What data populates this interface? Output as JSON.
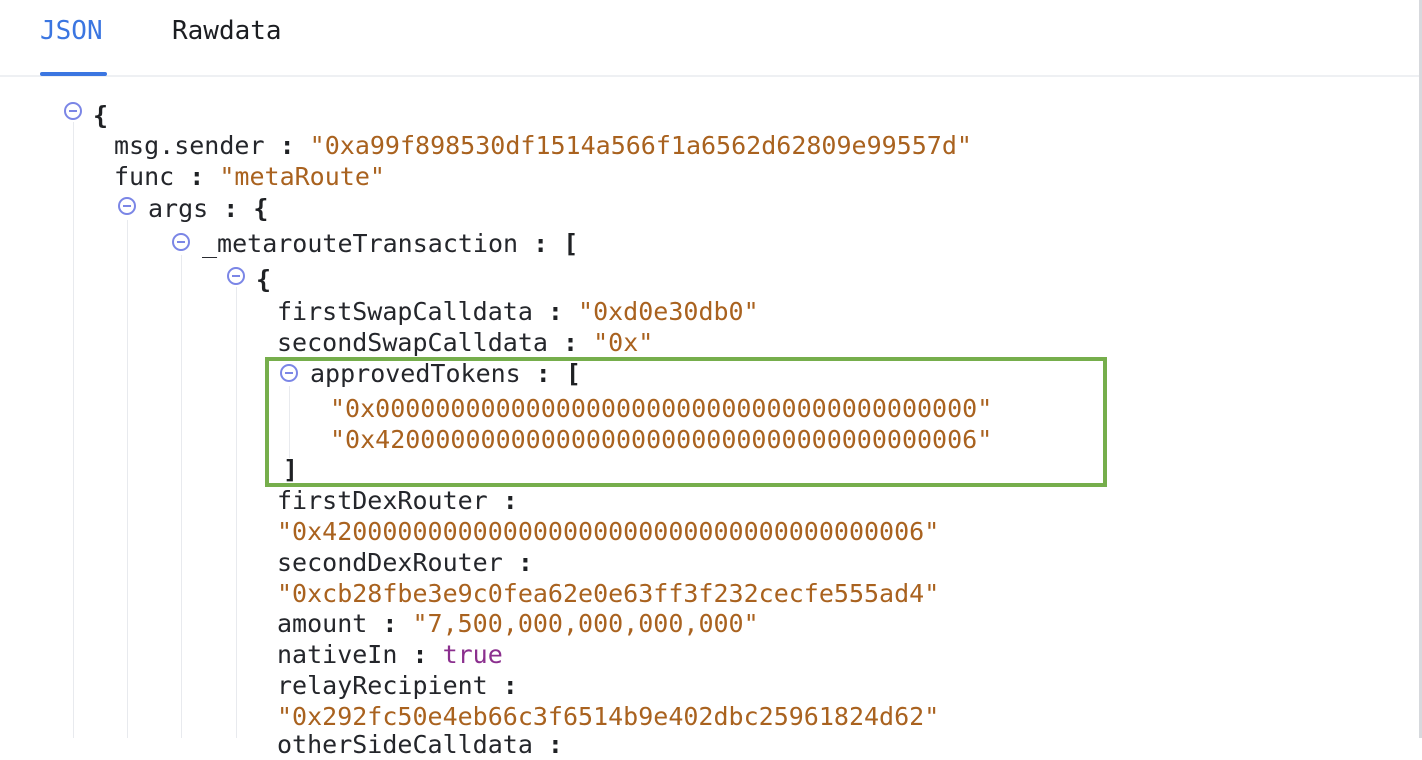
{
  "tabs": {
    "json": "JSON",
    "rawdata": "Rawdata"
  },
  "tree": {
    "open_brace": "{",
    "msg_sender_key": "msg.sender",
    "msg_sender_value": "\"0xa99f898530df1514a566f1a6562d62809e99557d\"",
    "func_key": "func",
    "func_value": "\"metaRoute\"",
    "args_key": "args",
    "metaroute_key": "_metarouteTransaction",
    "open_bracket": "[",
    "close_bracket": "]",
    "first_swap_key": "firstSwapCalldata",
    "first_swap_value": "\"0xd0e30db0\"",
    "second_swap_key": "secondSwapCalldata",
    "second_swap_value": "\"0x\"",
    "approved_tokens_key": "approvedTokens",
    "approved_tokens": [
      "\"0x0000000000000000000000000000000000000000\"",
      "\"0x4200000000000000000000000000000000000006\""
    ],
    "first_dex_key": "firstDexRouter",
    "first_dex_value": "\"0x4200000000000000000000000000000000000006\"",
    "second_dex_key": "secondDexRouter",
    "second_dex_value": "\"0xcb28fbe3e9c0fea62e0e63ff3f232cecfe555ad4\"",
    "amount_key": "amount",
    "amount_value": "\"7,500,000,000,000,000\"",
    "native_in_key": "nativeIn",
    "native_in_value": "true",
    "relay_recipient_key": "relayRecipient",
    "relay_recipient_value": "\"0x292fc50e4eb66c3f6514b9e402dbc25961824d62\"",
    "next_key_partial": "otherSideCalldata"
  },
  "colors": {
    "accent": "#3b76e1",
    "string": "#a9621f",
    "boolean": "#8b2f8e",
    "toggle": "#7b86e6",
    "highlight": "#76ae4c"
  },
  "icons": {
    "toggle": "collapse-circle-minus-icon"
  }
}
